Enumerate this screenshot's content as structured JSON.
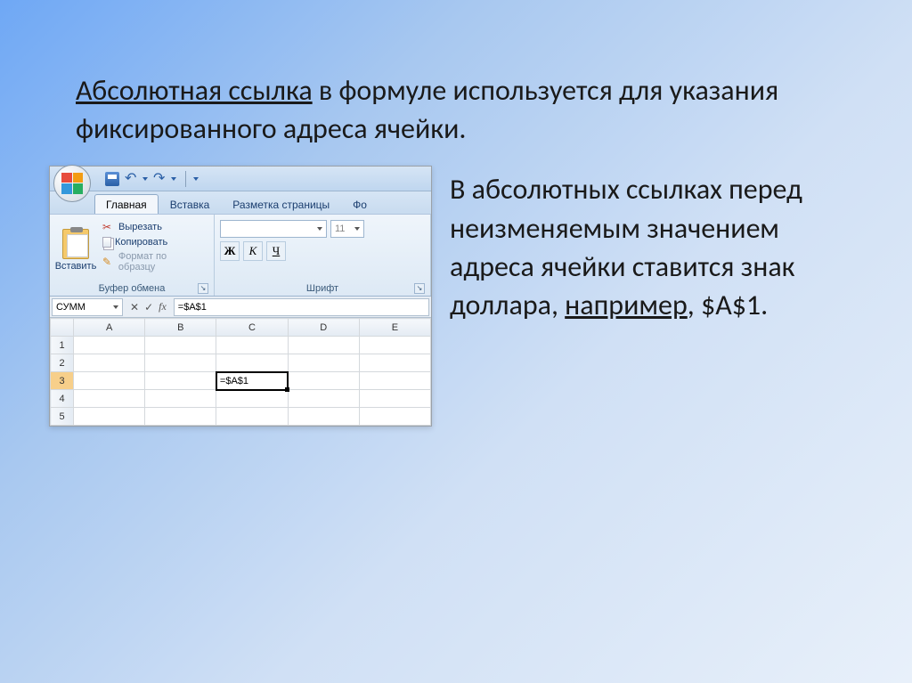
{
  "heading": {
    "underlined": "Абсолютная ссылка",
    "rest": " в формуле используется для указания фиксированного адреса ячейки."
  },
  "side_text": {
    "part1": "В абсолютных ссылках перед неизменяемым значением адреса ячейки ставится знак доллара, ",
    "underlined": "например",
    "part2": ", $A$1."
  },
  "excel": {
    "tabs": {
      "home": "Главная",
      "insert": "Вставка",
      "page_layout": "Разметка страницы",
      "formulas": "Фо"
    },
    "clipboard": {
      "paste": "Вставить",
      "cut": "Вырезать",
      "copy": "Копировать",
      "format_painter": "Формат по образцу",
      "group_label": "Буфер обмена"
    },
    "font": {
      "size": "11",
      "bold": "Ж",
      "italic": "К",
      "underline": "Ч",
      "group_label": "Шрифт"
    },
    "formula_bar": {
      "name_box": "СУММ",
      "cancel": "✕",
      "enter": "✓",
      "formula": "=$A$1"
    },
    "grid": {
      "columns": [
        "A",
        "B",
        "C",
        "D",
        "E"
      ],
      "rows": [
        "1",
        "2",
        "3",
        "4",
        "5"
      ],
      "active_cell_value": "=$A$1"
    }
  }
}
